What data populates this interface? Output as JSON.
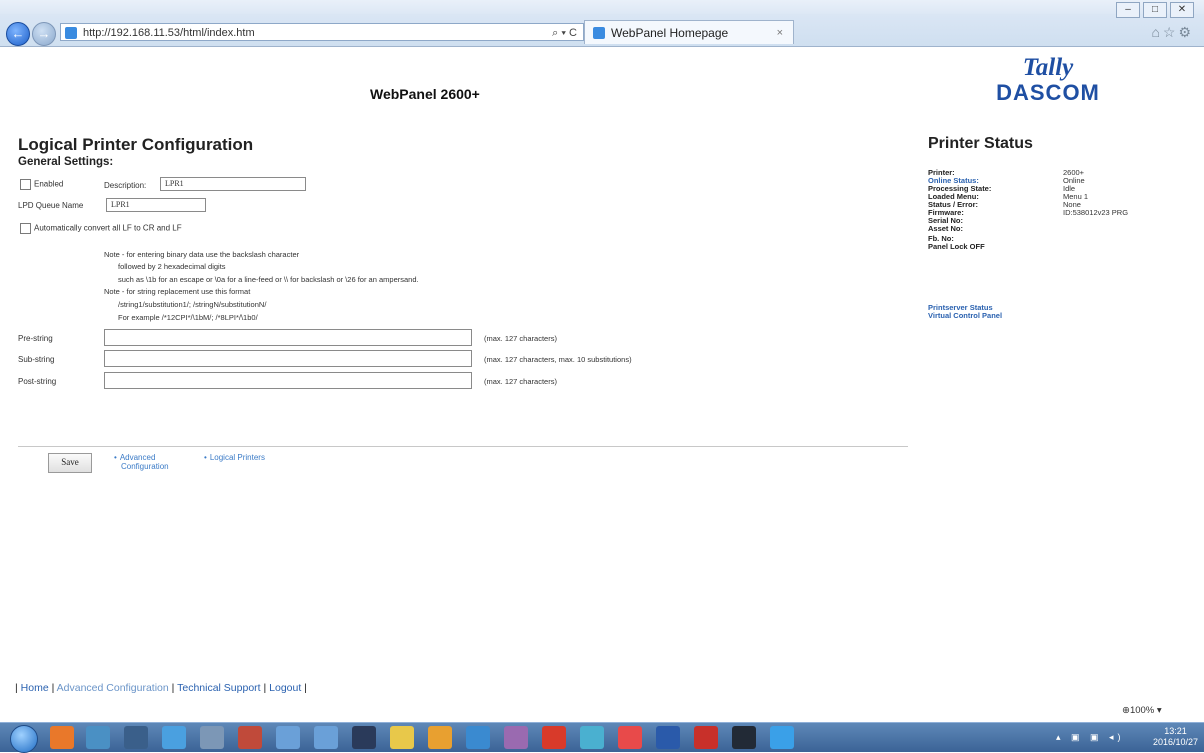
{
  "browser": {
    "url": "http://192.168.11.53/html/index.htm",
    "address_tools": "⌕ ▾ C",
    "tab_title": "WebPanel Homepage",
    "tab_close": "×",
    "win_minimize": "–",
    "win_maximize": "□",
    "win_close": "✕",
    "icons": "⌂☆⚙"
  },
  "header": {
    "title": "WebPanel 2600+",
    "logo_line1": "Tally",
    "logo_line2": "DASCOM"
  },
  "main": {
    "title": "Logical Printer Configuration",
    "general_settings": "General Settings:",
    "enabled_label": "Enabled",
    "description_label": "Description:",
    "description_value": "LPR1",
    "lpd_queue_label": "LPD Queue Name",
    "lpd_queue_value": "LPR1",
    "convert_label": "Automatically convert all LF to CR and LF",
    "notes": [
      "Note - for entering binary data use the backslash character",
      "followed by 2 hexadecimal digits",
      "such as \\1b for an escape or \\0a for a line-feed or \\\\ for backslash or \\26 for an ampersand.",
      "Note - for string replacement use this format",
      "/string1/substitution1/; /stringN/substitutionN/",
      "For example /*12CPI*/\\1bM/; /*8LPI*/\\1b0/"
    ],
    "pre_string_label": "Pre-string",
    "pre_string_hint": "(max. 127 characters)",
    "sub_string_label": "Sub-string",
    "sub_string_hint": "(max. 127 characters, max. 10 substitutions)",
    "post_string_label": "Post-string",
    "post_string_hint": "(max. 127 characters)",
    "save_button": "Save",
    "link_advanced_1": "Advanced",
    "link_advanced_2": "Configuration",
    "link_logical": "Logical Printers"
  },
  "status": {
    "title": "Printer Status",
    "printer_label": "Printer:",
    "printer_value": "2600+",
    "online_label": "Online Status:",
    "online_value": "Online",
    "processing_label": "Processing State:",
    "processing_value": "Idle",
    "menu_label": "Loaded Menu:",
    "menu_value": "Menu 1",
    "error_label": "Status / Error:",
    "error_value": "None",
    "firmware_label": "Firmware:",
    "firmware_value": "ID:538012v23 PRG",
    "serial_label": "Serial No:",
    "asset_label": "Asset No:",
    "fb_label": "Fb. No:",
    "panel_lock": "Panel Lock OFF",
    "printserver_link": "Printserver Status",
    "vcp_link": "Virtual Control Panel"
  },
  "footer": {
    "sep1": "| ",
    "home": "Home",
    "sep2": " | ",
    "advanced": "Advanced Configuration",
    "sep3": " | ",
    "support": "Technical Support",
    "sep4": " | ",
    "logout": "Logout",
    "sep5": " |",
    "zoom": "⊕100%  ▾"
  },
  "taskbar": {
    "time": "13:21",
    "date": "2016/10/27",
    "tray_icons": "▴ ▣ ▣ ◂)"
  }
}
